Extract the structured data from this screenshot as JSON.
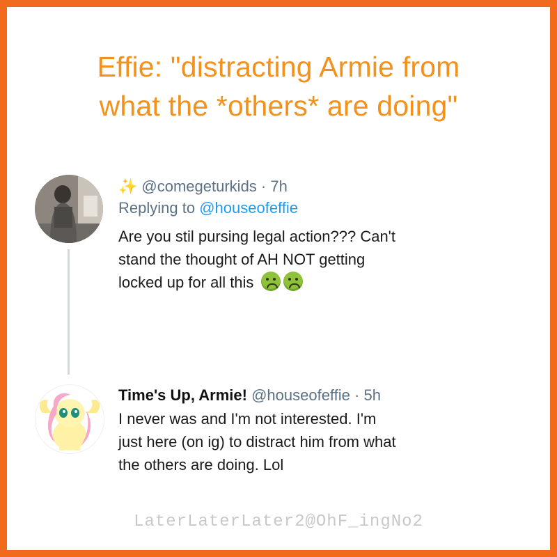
{
  "headline": {
    "line1": "Effie: \"distracting Armie from",
    "line2": "what the *others* are doing\""
  },
  "tweet1": {
    "handle": "@comegeturkids",
    "time": "7h",
    "reply_prefix": "Replying to",
    "reply_to": "@houseofeffie",
    "body_line1": "Are you stil pursing legal action??? Can't",
    "body_line2": "stand the thought of AH NOT getting",
    "body_line3": "locked up for all this",
    "emoji": "nauseated-face-icon"
  },
  "tweet2": {
    "display_name": "Time's Up, Armie!",
    "handle": "@houseofeffie",
    "time": "5h",
    "body_line1": "I never was and I'm not interested. I'm",
    "body_line2": "just here (on ig) to distract him from what",
    "body_line3": "the others are doing. Lol"
  },
  "watermark": "LaterLaterLater2@OhF_ingNo2",
  "colors": {
    "frame": "#f26a1b",
    "headline": "#f2911c",
    "mention": "#1d9bf0"
  }
}
